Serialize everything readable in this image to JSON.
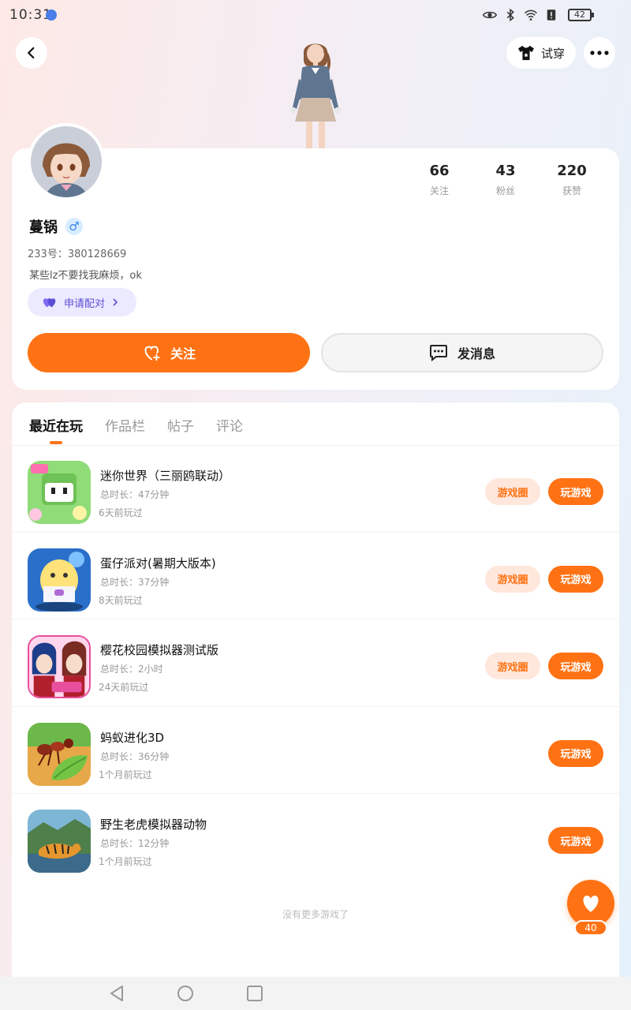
{
  "status_bar": {
    "time": "10:31",
    "battery": "42"
  },
  "header": {
    "tryon_label": "试穿"
  },
  "profile": {
    "username": "蔓锅",
    "gender_symbol": "♂",
    "uid": "233号：380128669",
    "bio": "某些lz不要找我麻烦，ok",
    "match_label": "申请配对",
    "follow_label": "关注",
    "message_label": "发消息",
    "stats": [
      {
        "value": "66",
        "label": "关注"
      },
      {
        "value": "43",
        "label": "粉丝"
      },
      {
        "value": "220",
        "label": "获赞"
      }
    ]
  },
  "tabs": [
    {
      "label": "最近在玩",
      "active": true
    },
    {
      "label": "作品栏",
      "active": false
    },
    {
      "label": "帖子",
      "active": false
    },
    {
      "label": "评论",
      "active": false
    }
  ],
  "games": [
    {
      "title": "迷你世界（三丽鸥联动）",
      "duration": "总时长：47分钟",
      "last_played": "6天前玩过",
      "circle_label": "游戏圈",
      "play_label": "玩游戏",
      "has_circle": true,
      "icon_name": "mini-world-game-icon",
      "icon_colors": [
        "#7fd46a",
        "#ffffff"
      ]
    },
    {
      "title": "蛋仔派对(暑期大版本)",
      "duration": "总时长：37分钟",
      "last_played": "8天前玩过",
      "circle_label": "游戏圈",
      "play_label": "玩游戏",
      "has_circle": true,
      "icon_name": "eggy-party-game-icon",
      "icon_colors": [
        "#2a6fc9",
        "#ffe27a"
      ]
    },
    {
      "title": "樱花校园模拟器测试版",
      "duration": "总时长：2小时",
      "last_played": "24天前玩过",
      "circle_label": "游戏圈",
      "play_label": "玩游戏",
      "has_circle": true,
      "icon_name": "sakura-school-game-icon",
      "icon_colors": [
        "#e84f9c",
        "#ffd6ec"
      ]
    },
    {
      "title": "蚂蚁进化3D",
      "duration": "总时长：36分钟",
      "last_played": "1个月前玩过",
      "circle_label": "",
      "play_label": "玩游戏",
      "has_circle": false,
      "icon_name": "ant-evolution-game-icon",
      "icon_colors": [
        "#c98a2c",
        "#7cc246"
      ]
    },
    {
      "title": "野生老虎模拟器动物",
      "duration": "总时长：12分钟",
      "last_played": "1个月前玩过",
      "circle_label": "",
      "play_label": "玩游戏",
      "has_circle": false,
      "icon_name": "wild-tiger-game-icon",
      "icon_colors": [
        "#5aa0c8",
        "#e5962e"
      ]
    }
  ],
  "no_more_text": "没有更多游戏了",
  "like": {
    "count": "40"
  },
  "colors": {
    "accent": "#ff7214",
    "match_bg": "#eceaff",
    "match_text": "#5a4fd6",
    "gender": "#3a86e8"
  }
}
